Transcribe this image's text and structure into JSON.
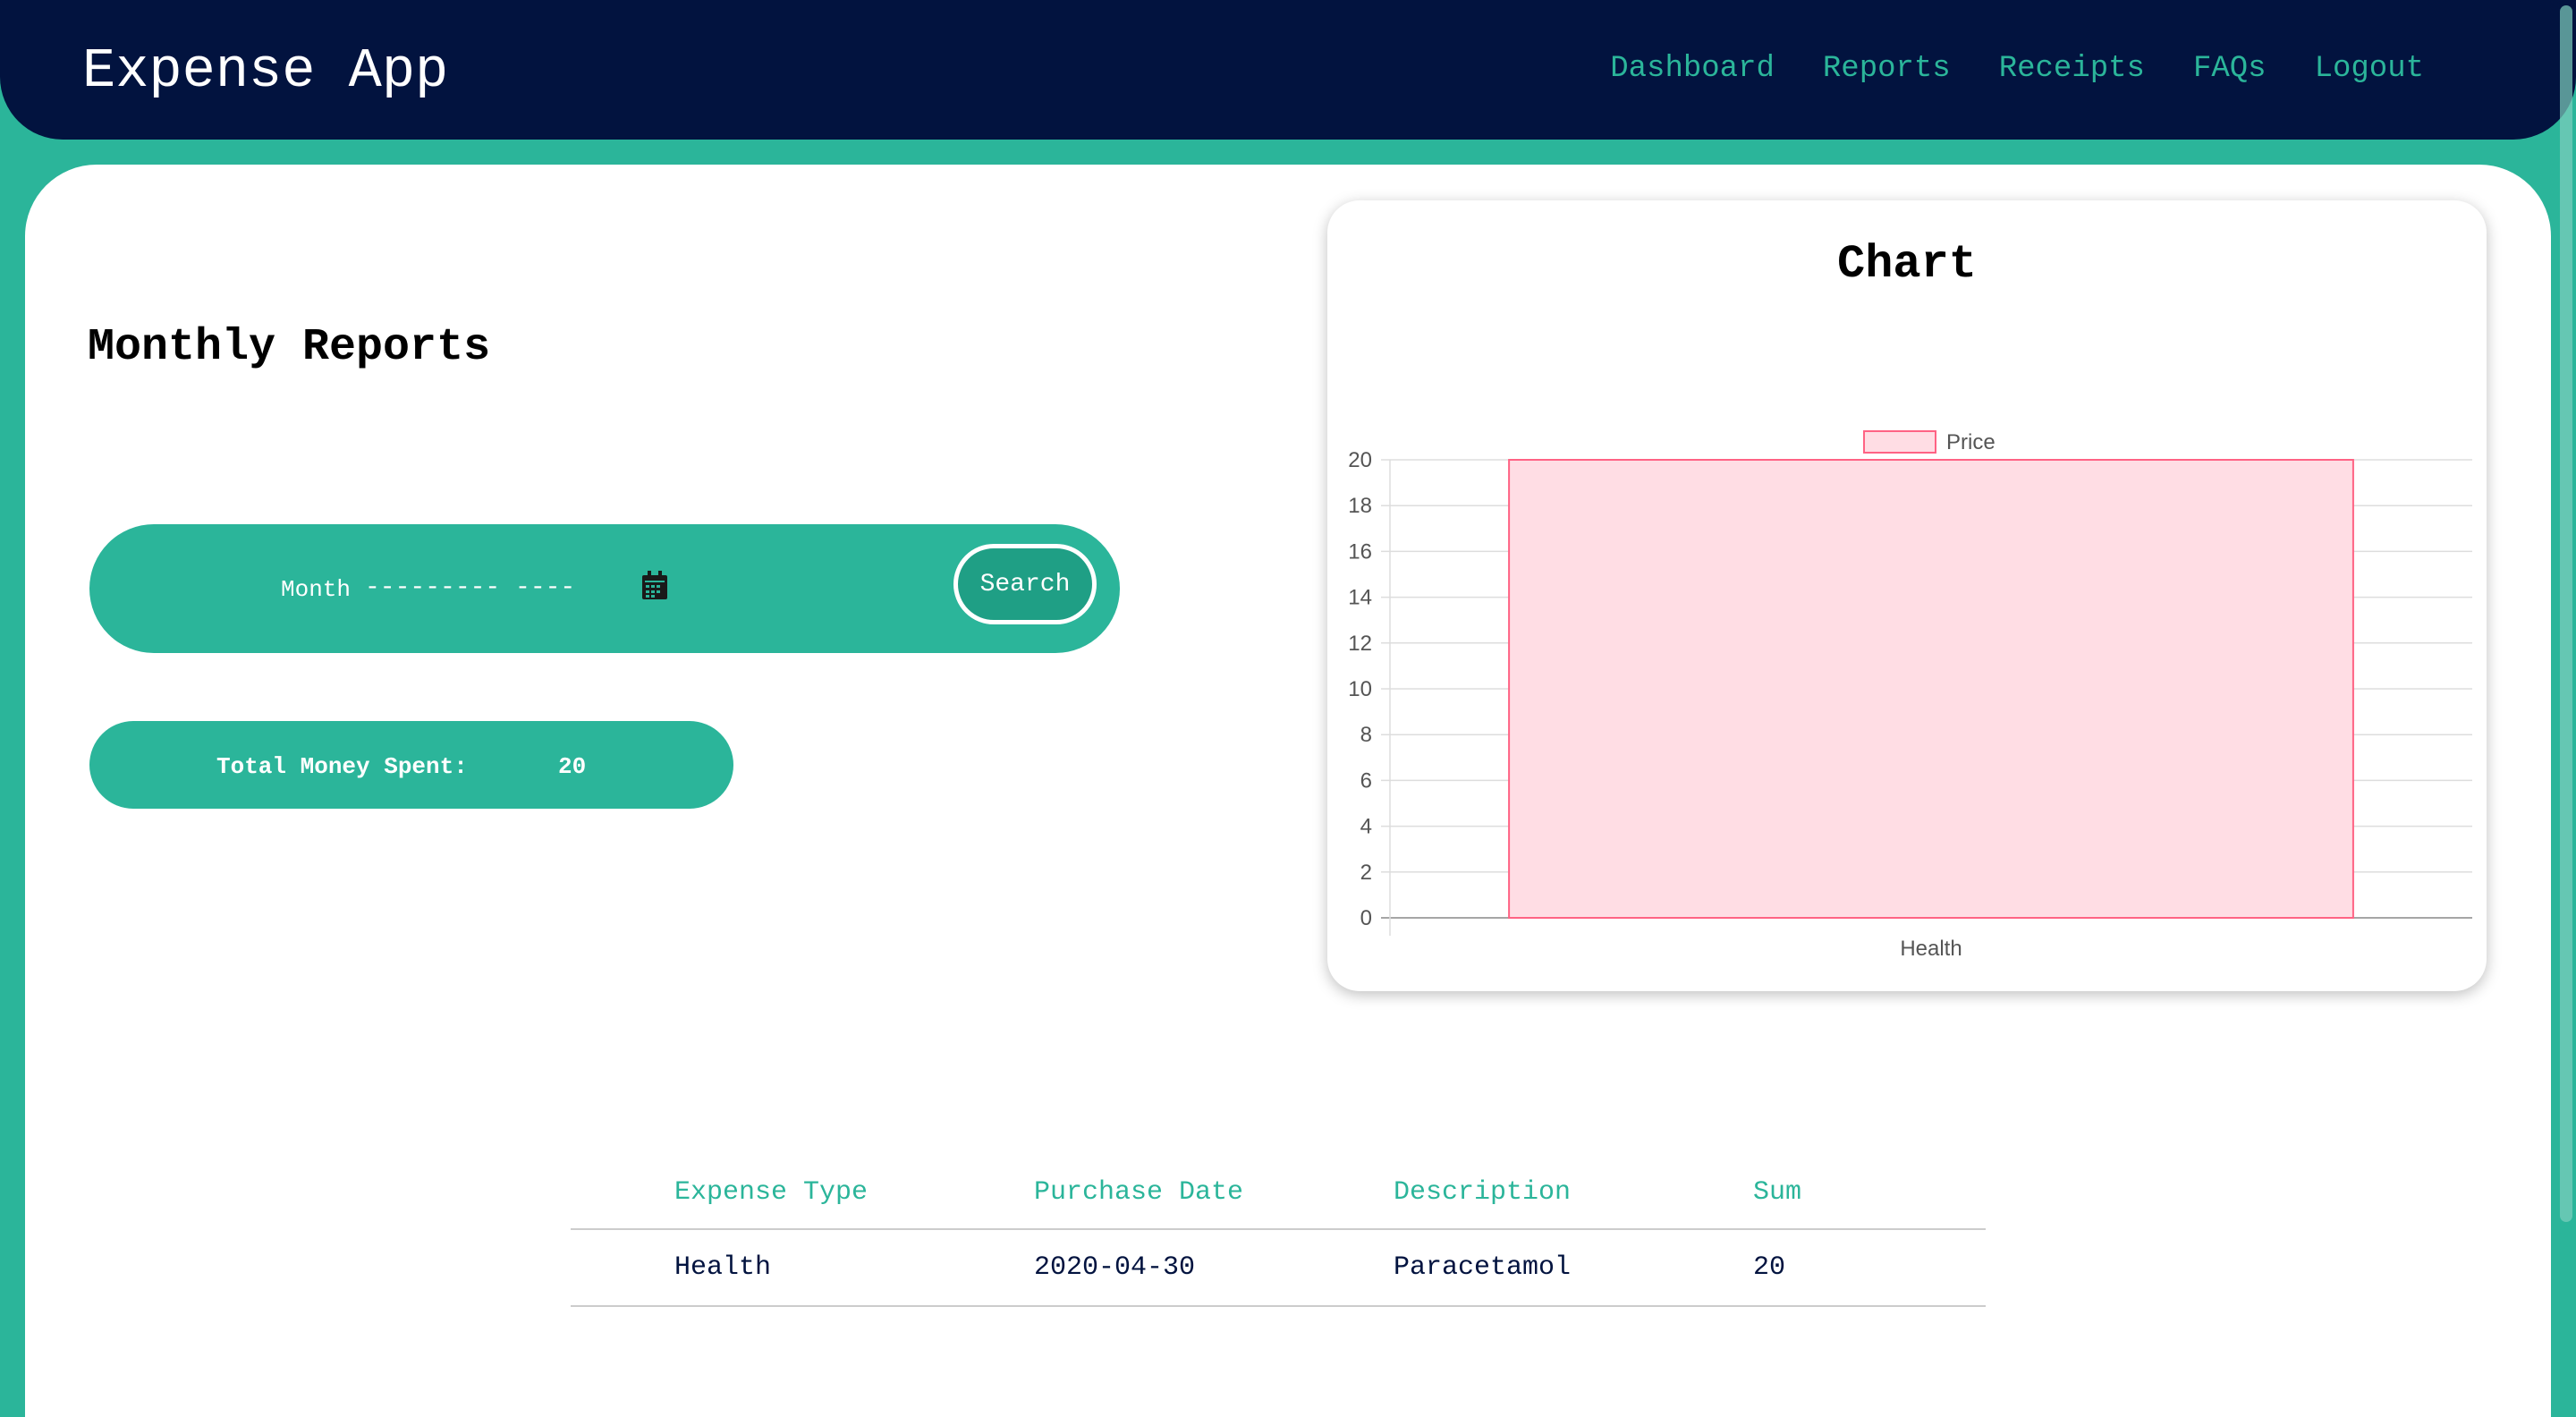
{
  "app": {
    "title": "Expense App"
  },
  "nav": {
    "items": [
      "Dashboard",
      "Reports",
      "Receipts",
      "FAQs",
      "Logout"
    ]
  },
  "page": {
    "title": "Monthly Reports"
  },
  "search": {
    "month_label": "Month",
    "month_placeholder": "--------- ----",
    "button_label": "Search"
  },
  "total": {
    "label": "Total Money Spent:",
    "value": "20"
  },
  "chart": {
    "card_title": "Chart"
  },
  "chart_data": {
    "type": "bar",
    "categories": [
      "Health"
    ],
    "series": [
      {
        "name": "Price",
        "values": [
          20
        ]
      }
    ],
    "ylim": [
      0,
      20
    ],
    "yticks": [
      0,
      2,
      4,
      6,
      8,
      10,
      12,
      14,
      16,
      18,
      20
    ],
    "legend": "top-center",
    "grid": true,
    "colors": {
      "fill": "#ffdde4",
      "stroke": "#ff6384"
    }
  },
  "table": {
    "headers": [
      "Expense Type",
      "Purchase Date",
      "Description",
      "Sum"
    ],
    "rows": [
      [
        "Health",
        "2020-04-30",
        "Paracetamol",
        "20"
      ]
    ]
  },
  "colors": {
    "navy": "#02133f",
    "teal": "#2bb59a"
  }
}
